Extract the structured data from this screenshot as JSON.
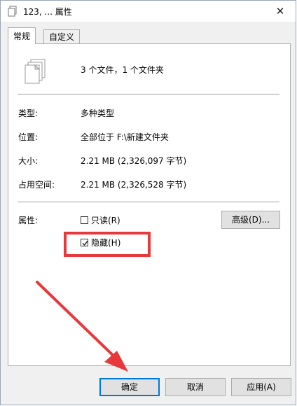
{
  "window": {
    "title": "123, ... 属性",
    "close_glyph": "✕"
  },
  "tabs": [
    {
      "label": "常规",
      "active": true
    },
    {
      "label": "自定义",
      "active": false
    }
  ],
  "summary": {
    "text": "3 个文件，1 个文件夹"
  },
  "properties": [
    {
      "label": "类型:",
      "value": "多种类型"
    },
    {
      "label": "位置:",
      "value": "全部位于 F:\\新建文件夹"
    },
    {
      "label": "大小:",
      "value": "2.21 MB (2,326,097 字节)"
    },
    {
      "label": "占用空间:",
      "value": "2.21 MB (2,326,528 字节)"
    }
  ],
  "attributes": {
    "label": "属性:",
    "readonly": {
      "label": "只读(R)",
      "checked": false
    },
    "hidden": {
      "label": "隐藏(H)",
      "checked": true
    },
    "advanced_button": "高级(D)..."
  },
  "buttons": {
    "ok": "确定",
    "cancel": "取消",
    "apply": "应用(A)"
  },
  "colors": {
    "highlight": "#e8383b",
    "accent": "#0078d7"
  },
  "icons": {
    "title": "files-icon",
    "summary": "multiple-files-icon"
  }
}
